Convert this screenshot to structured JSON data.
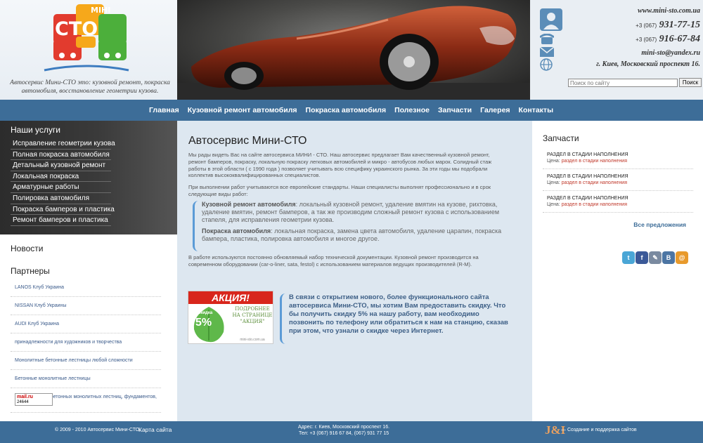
{
  "header": {
    "tagline": "Автосервис Мини-СТО это: кузовной ремонт, покраска автомобиля, восстановление геометрии кузова.",
    "logo": {
      "top_text": "МІНІ",
      "main_text": "СТО"
    },
    "site_url": "www.mini-sto.com.ua",
    "phone1_code": "+3 (067)",
    "phone1_num": "931-77-15",
    "phone2_code": "+3 (067)",
    "phone2_num": "916-67-84",
    "email": "mini-sto@yandex.ru",
    "address": "г. Киев, Московский проспект 16.",
    "search_placeholder": "Поиск по сайту",
    "search_button": "Поиск"
  },
  "nav": {
    "items": [
      "Главная",
      "Кузовной ремонт автомобиля",
      "Покраска автомобиля",
      "Полезное",
      "Запчасти",
      "Галерея",
      "Контакты"
    ]
  },
  "left": {
    "services_title": "Наши услуги",
    "services": [
      "Исправление геометрии кузова",
      "Полная покраска автомобиля",
      "Детальный кузовной ремонт",
      "Локальная покраска",
      "Арматурные работы",
      "Полировка автомобиля",
      "Покраска бамперов и пластика",
      "Ремонт бамперов и пластика"
    ],
    "news_title": "Новости",
    "partners_title": "Партнеры",
    "partners": [
      "LANOS Клуб Украина",
      "NISSAN Клуб Украины",
      "AUDI Клуб Украина",
      "принадлежности для художников и творчества",
      "Монолитные бетонные лестницы любой сложности",
      "Бетонные монолитные лестницы",
      "Строительство бетонных монолитных лестниц, фундаментов, бассейнов спб"
    ],
    "counter": {
      "brand": "mail.ru",
      "value": "24644"
    }
  },
  "main": {
    "title": "Автосервис Мини-СТО",
    "intro": "Мы рады видеть Вас на сайте автосервиса МИНИ - СТО. Наш автосервис предлагает Вам качественный кузовной ремонт, ремонт бамперов, покраску, локальную покраску легковых автомобилей и микро - автобусов любых марок. Солидный стаж работы в этой области ( с 1990 года ) позволяет учитывать всю специфику украинского рынка. За эти годы мы подобрали коллектив высококвалифицированных специалистов.",
    "intro2": "При выполнении работ учитываются все европейские стандарты. Наши специалисты выполнят профессионально и в срок следующие виды работ:",
    "body_repair_label": "Кузовной ремонт автомобиля",
    "body_repair_text": ": локальный кузовной ремонт, удаление вмятин на кузове, рихтовка, удаление вмятин, ремонт бамперов, а так же производим сложный ремонт кузова с использованием стапеля, для исправления геометрии кузова.",
    "paint_label": "Покраска автомобиля",
    "paint_text": ": локальная покраска, замена цвета автомобиля, удаление царапин, покраска бампера, пластика, полировка автомобиля и многое другое.",
    "tech": "В работе используются постоянно обновляемый набор технической документации. Кузовной ремонт производится на современном оборудовании (car-o-liner, sata, festol) с использованием материалов ведущих производителей (R-M).",
    "promo": {
      "banner": "АКЦИЯ!",
      "discount": "5%",
      "discount_label": "скидка",
      "side_text": "ПОДРОБНЕЕ НА СТРАНИЦЕ \"АКЦИЯ\"",
      "site": "mini-sto.com.ua",
      "text": "В связи с открытием нового, более функционального сайта автосервиса Мини-СТО, мы хотим Вам предоставить скидку. Что бы получить скидку 5% на нашу работу, вам необходимо позвонить по телефону или обратиться к нам на станцию, сказав при этом, что узнали о скидке через Интернет."
    }
  },
  "right": {
    "parts_title": "Запчасти",
    "parts": [
      {
        "name": "РАЗДЕЛ В СТАДИИ НАПОЛНЕНИЯ",
        "price_label": "Цена:",
        "price": "раздел в стадии наполнения"
      },
      {
        "name": "РАЗДЕЛ В СТАДИИ НАПОЛНЕНИЯ",
        "price_label": "Цена:",
        "price": "раздел в стадии наполнения"
      },
      {
        "name": "РАЗДЕЛ В СТАДИИ НАПОЛНЕНИЯ",
        "price_label": "Цена:",
        "price": "раздел в стадии наполнения"
      }
    ],
    "all_offers": "Все предложения",
    "social": [
      {
        "name": "twitter",
        "glyph": "t",
        "color": "#4aa6d6"
      },
      {
        "name": "facebook",
        "glyph": "f",
        "color": "#3b5998"
      },
      {
        "name": "livejournal",
        "glyph": "✎",
        "color": "#7a8aa0"
      },
      {
        "name": "vkontakte",
        "glyph": "В",
        "color": "#4c75a3"
      },
      {
        "name": "mailru",
        "glyph": "@",
        "color": "#e89a2c"
      }
    ]
  },
  "footer": {
    "copyright": "© 2009 - 2010 Автосервис Мини-СТО.",
    "sitemap": "Карта сайта",
    "address": "Адрес: г. Киев, Московский проспект 16.",
    "phones": "Тел: +3 (067) 916 67 84, (067) 931 77 15",
    "dev_logo": "J&I",
    "dev_text": "— Создание и поддержка сайтов"
  }
}
